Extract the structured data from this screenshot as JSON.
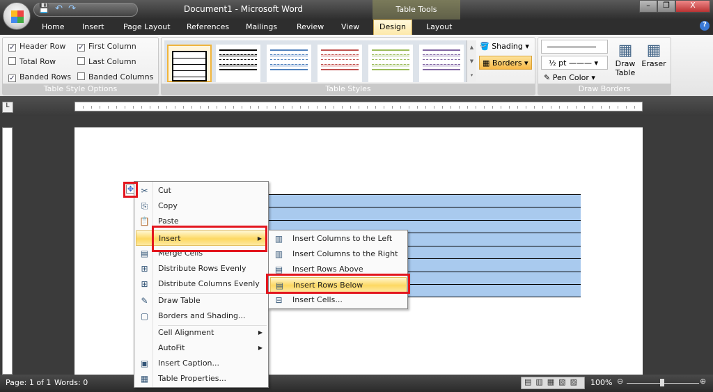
{
  "window": {
    "title": "Document1 - Microsoft Word",
    "contextual_tab_group": "Table Tools",
    "controls": [
      "minimize",
      "restore",
      "close"
    ]
  },
  "tabs": [
    "Home",
    "Insert",
    "Page Layout",
    "References",
    "Mailings",
    "Review",
    "View",
    "Design",
    "Layout"
  ],
  "active_tab": "Design",
  "ribbon": {
    "table_style_options": {
      "label": "Table Style Options",
      "options": [
        {
          "label": "Header Row",
          "checked": true
        },
        {
          "label": "Total Row",
          "checked": false
        },
        {
          "label": "Banded Rows",
          "checked": true
        },
        {
          "label": "First Column",
          "checked": true
        },
        {
          "label": "Last Column",
          "checked": false
        },
        {
          "label": "Banded Columns",
          "checked": false
        }
      ]
    },
    "table_styles": {
      "label": "Table Styles",
      "style_colors": [
        "#000000",
        "#000000",
        "#4f81bd",
        "#c0504d",
        "#9bbb59",
        "#8064a2"
      ],
      "shading": "Shading",
      "borders": "Borders"
    },
    "draw_borders": {
      "label": "Draw Borders",
      "line_weight": "½ pt",
      "pen_color": "Pen Color",
      "draw_table": "Draw Table",
      "eraser": "Eraser"
    }
  },
  "context_menu": {
    "items": [
      {
        "label": "Cut",
        "icon": "scissors-icon"
      },
      {
        "label": "Copy",
        "icon": "copy-icon"
      },
      {
        "label": "Paste",
        "icon": "paste-icon"
      },
      {
        "label": "Insert",
        "icon": "",
        "submenu": true,
        "highlighted": true
      },
      {
        "label": "Merge Cells",
        "icon": "merge-cells-icon"
      },
      {
        "label": "Distribute Rows Evenly",
        "icon": "distribute-rows-icon"
      },
      {
        "label": "Distribute Columns Evenly",
        "icon": "distribute-columns-icon"
      },
      {
        "label": "Draw Table",
        "icon": "pencil-icon"
      },
      {
        "label": "Borders and Shading...",
        "icon": "borders-icon"
      },
      {
        "label": "Cell Alignment",
        "icon": "",
        "submenu": true
      },
      {
        "label": "AutoFit",
        "icon": "",
        "submenu": true
      },
      {
        "label": "Insert Caption...",
        "icon": "caption-icon"
      },
      {
        "label": "Table Properties...",
        "icon": "table-properties-icon"
      }
    ]
  },
  "insert_submenu": {
    "items": [
      {
        "label": "Insert Columns to the Left"
      },
      {
        "label": "Insert Columns to the Right"
      },
      {
        "label": "Insert Rows Above"
      },
      {
        "label": "Insert Rows Below",
        "highlighted": true
      },
      {
        "label": "Insert Cells..."
      }
    ]
  },
  "status": {
    "page": "Page: 1 of 1",
    "words": "Words: 0",
    "zoom": "100%"
  },
  "colors": {
    "highlight": "#e3161e",
    "table_selection": "#a9caee"
  }
}
